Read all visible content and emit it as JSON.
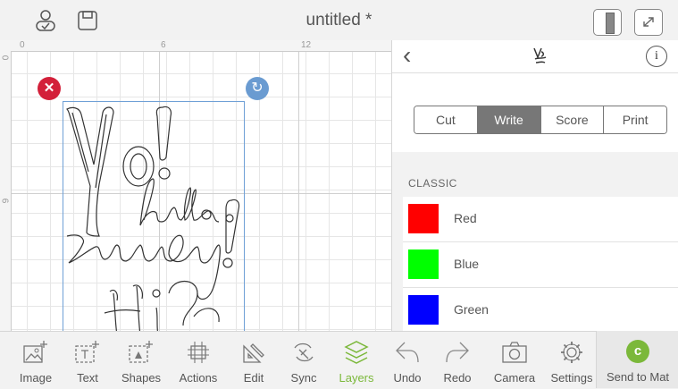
{
  "header": {
    "title": "untitled *"
  },
  "canvas": {
    "ruler_top": [
      "0",
      "6",
      "12"
    ],
    "ruler_left": [
      "0",
      "6"
    ]
  },
  "panel": {
    "tabs": [
      {
        "label": "Cut",
        "active": false
      },
      {
        "label": "Write",
        "active": true
      },
      {
        "label": "Score",
        "active": false
      },
      {
        "label": "Print",
        "active": false
      }
    ],
    "section": "CLASSIC",
    "pens": [
      {
        "name": "Red",
        "color": "#ff0000"
      },
      {
        "name": "Blue",
        "color": "#00ff00"
      },
      {
        "name": "Green",
        "color": "#0000ff"
      }
    ]
  },
  "toolbar": {
    "items": [
      {
        "label": "Image",
        "icon": "image-add-icon"
      },
      {
        "label": "Text",
        "icon": "text-add-icon"
      },
      {
        "label": "Shapes",
        "icon": "shapes-add-icon"
      },
      {
        "label": "Actions",
        "icon": "actions-icon"
      },
      {
        "label": "Edit",
        "icon": "edit-icon"
      },
      {
        "label": "Sync",
        "icon": "sync-icon"
      },
      {
        "label": "Layers",
        "icon": "layers-icon",
        "active": true
      },
      {
        "label": "Undo",
        "icon": "undo-icon"
      },
      {
        "label": "Redo",
        "icon": "redo-icon"
      },
      {
        "label": "Camera",
        "icon": "camera-icon"
      },
      {
        "label": "Settings",
        "icon": "settings-icon"
      }
    ],
    "send_label": "Send to Mat"
  },
  "colors": {
    "accent": "#7bb83a",
    "delete": "#d3203a",
    "rotate": "#6a9bd1"
  }
}
